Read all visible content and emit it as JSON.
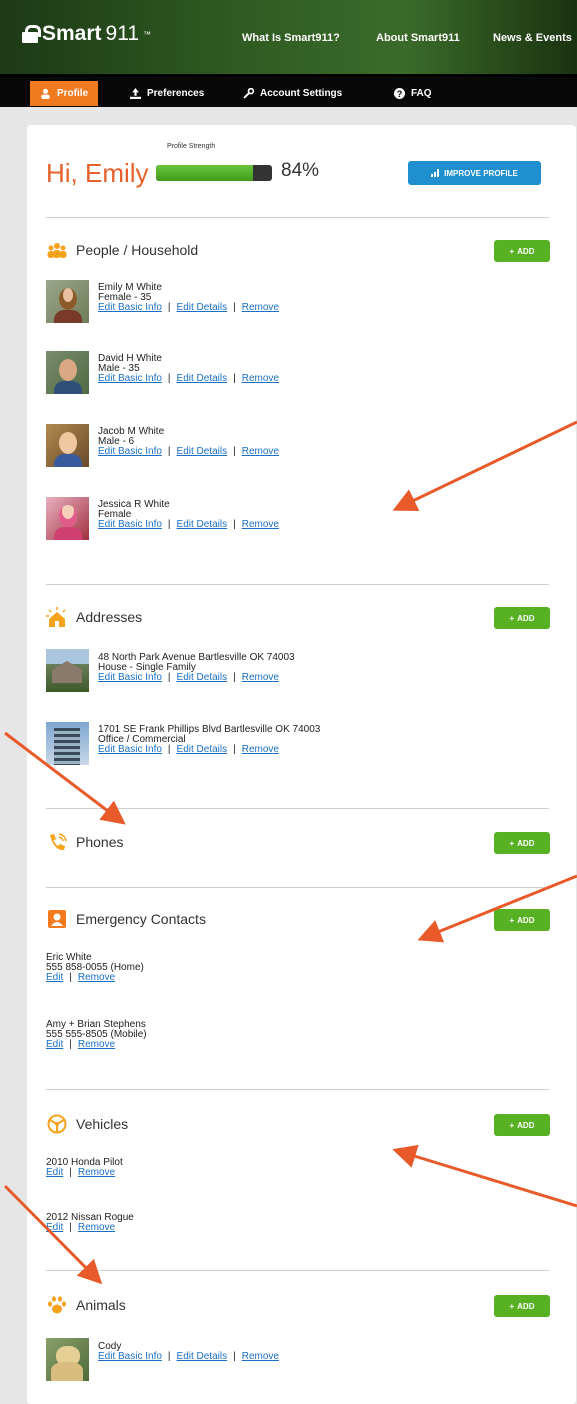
{
  "brand": {
    "logo_main": "Smart",
    "logo_thin": "911",
    "logo_tm": "™"
  },
  "top_nav": [
    "What Is Smart911?",
    "About Smart911",
    "News & Events"
  ],
  "sub_nav": [
    {
      "label": "Profile",
      "icon": "person-icon"
    },
    {
      "label": "Preferences",
      "icon": "upload-icon"
    },
    {
      "label": "Account Settings",
      "icon": "wrench-icon"
    },
    {
      "label": "FAQ",
      "icon": "help-icon"
    }
  ],
  "profile": {
    "greeting": "Hi, Emily",
    "strength_label": "Profile Strength",
    "strength_value": 0.84,
    "strength_text": "84%",
    "improve_label": "IMPROVE PROFILE"
  },
  "sections": {
    "people": {
      "title": "People / Household",
      "add": "ADD",
      "items": [
        {
          "name": "Emily M White",
          "detail": "Female - 35"
        },
        {
          "name": "David H White",
          "detail": "Male - 35"
        },
        {
          "name": "Jacob M White",
          "detail": "Male - 6"
        },
        {
          "name": "Jessica R White",
          "detail": "Female"
        }
      ],
      "link1": "Edit Basic Info",
      "link2": "Edit Details",
      "link3": "Remove"
    },
    "addresses": {
      "title": "Addresses",
      "add": "ADD",
      "items": [
        {
          "name": "48 North Park Avenue Bartlesville OK 74003",
          "detail": "House - Single Family"
        },
        {
          "name": "1701 SE Frank Phillips Blvd Bartlesville OK 74003",
          "detail": "Office / Commercial"
        }
      ]
    },
    "phones": {
      "title": "Phones",
      "add": "ADD"
    },
    "contacts": {
      "title": "Emergency Contacts",
      "add": "ADD",
      "items": [
        {
          "name": "Eric White",
          "detail": "555 858-0055 (Home)"
        },
        {
          "name": "Amy + Brian Stephens",
          "detail": "555 555-8505 (Mobile)"
        }
      ],
      "edit": "Edit",
      "remove": "Remove"
    },
    "vehicles": {
      "title": "Vehicles",
      "add": "ADD",
      "items": [
        {
          "name": "2010 Honda Pilot"
        },
        {
          "name": "2012 Nissan Rogue"
        }
      ]
    },
    "animals": {
      "title": "Animals",
      "add": "ADD",
      "items": [
        {
          "name": "Cody"
        }
      ]
    }
  },
  "colors": {
    "accent_orange": "#f07a20",
    "add_green": "#58b122",
    "link_blue": "#1b6fc4",
    "improve_blue": "#1f8fd0",
    "arrow": "#e85a2a"
  }
}
